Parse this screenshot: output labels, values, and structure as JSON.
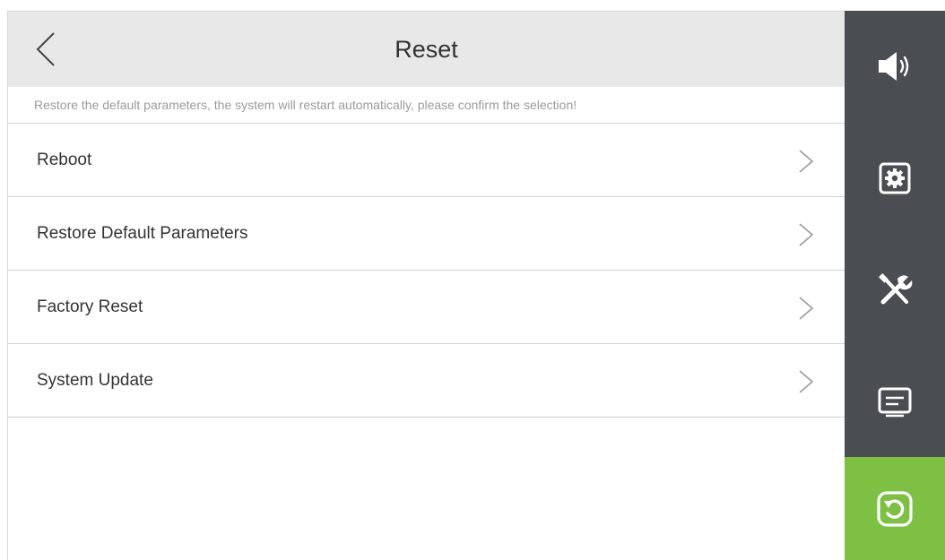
{
  "header": {
    "title": "Reset",
    "back_icon": "chevron-left-icon"
  },
  "hint": "Restore the default parameters, the system will restart automatically, please confirm the selection!",
  "menu": [
    {
      "label": "Reboot"
    },
    {
      "label": "Restore Default Parameters"
    },
    {
      "label": "Factory Reset"
    },
    {
      "label": "System Update"
    }
  ],
  "sidebar": {
    "items": [
      {
        "icon": "speaker-icon",
        "active": false
      },
      {
        "icon": "settings-icon",
        "active": false
      },
      {
        "icon": "tools-icon",
        "active": false
      },
      {
        "icon": "message-icon",
        "active": false
      },
      {
        "icon": "reset-icon",
        "active": true
      }
    ]
  },
  "colors": {
    "sidebar_bg": "#4a4d51",
    "active_accent": "#7dc043",
    "header_bg": "#e8e8e8"
  }
}
